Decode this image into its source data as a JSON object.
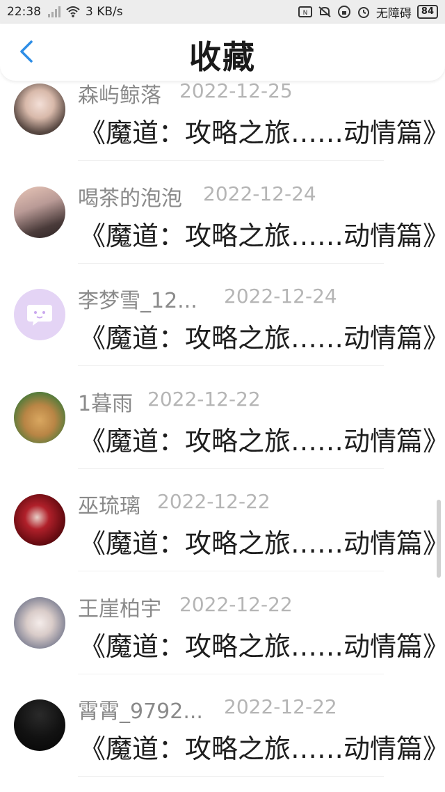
{
  "status": {
    "time": "22:38",
    "net_speed": "3 KB/s",
    "accessibility": "无障碍",
    "battery": "84"
  },
  "header": {
    "title": "收藏"
  },
  "items": [
    {
      "name": "森屿鲸落",
      "date": "2022-12-25",
      "post_title": "《魔道：攻略之旅……动情篇》"
    },
    {
      "name": "喝茶的泡泡",
      "date": "2022-12-24",
      "post_title": "《魔道：攻略之旅……动情篇》"
    },
    {
      "name": "李梦雪_12...",
      "date": "2022-12-24",
      "post_title": "《魔道：攻略之旅……动情篇》"
    },
    {
      "name": "1暮雨",
      "date": "2022-12-22",
      "post_title": "《魔道：攻略之旅……动情篇》"
    },
    {
      "name": "巫琉璃",
      "date": "2022-12-22",
      "post_title": "《魔道：攻略之旅……动情篇》"
    },
    {
      "name": "王崖柏宇",
      "date": "2022-12-22",
      "post_title": "《魔道：攻略之旅……动情篇》"
    },
    {
      "name": "霄霄_9792...",
      "date": "2022-12-22",
      "post_title": "《魔道：攻略之旅……动情篇》"
    }
  ],
  "colors": {
    "accent": "#2f8ee6",
    "name_gray": "#8a8a8a",
    "date_gray": "#b5b5b5"
  },
  "icons": [
    "back-icon",
    "wifi-icon",
    "signal-icon",
    "alarm-icon",
    "mute-icon",
    "battery-icon"
  ]
}
